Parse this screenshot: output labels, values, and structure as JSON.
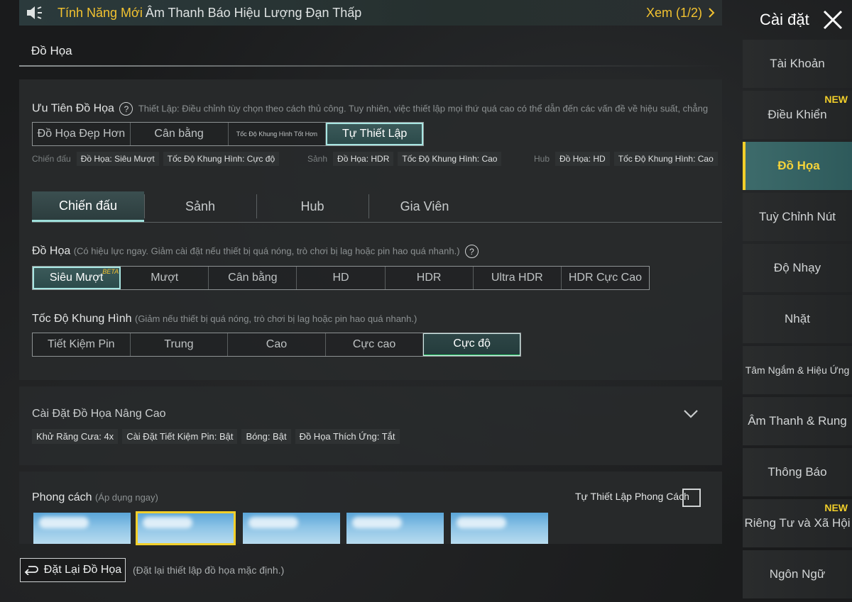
{
  "announcement": {
    "highlight": "Tính Năng Mới",
    "text": "Âm Thanh Báo Hiệu Lượng Đạn Thấp",
    "view": "Xem (1/2)"
  },
  "page": {
    "title": "Đồ Họa"
  },
  "priority": {
    "title": "Ưu Tiên Đồ Họa",
    "desc": "Thiết Lập: Điều chỉnh tùy chọn theo cách thủ công. Tuy nhiên, việc thiết lập mọi thứ quá cao có thể dẫn đến các vấn đề về hiệu suất, chẳng",
    "options": [
      "Đồ Họa Đẹp Hơn",
      "Cân bằng",
      "Tốc Độ Khung Hình Tốt Hơn",
      "Tự Thiết Lập"
    ],
    "selected": "Tự Thiết Lập",
    "summary": {
      "battle_label": "Chiến đấu",
      "battle_tags": [
        "Đồ Họa: Siêu Mượt",
        "Tốc Độ Khung Hình: Cực độ"
      ],
      "lobby_label": "Sảnh",
      "lobby_tags": [
        "Đồ Họa: HDR",
        "Tốc Độ Khung Hình: Cao"
      ],
      "hub_label": "Hub",
      "hub_tags": [
        "Đồ Họa: HD",
        "Tốc Độ Khung Hình: Cao"
      ]
    }
  },
  "tabs": [
    "Chiến đấu",
    "Sảnh",
    "Hub",
    "Gia Viên"
  ],
  "active_tab": "Chiến đấu",
  "graphics": {
    "title": "Đồ Họa",
    "sub": "(Có hiệu lực ngay. Giảm cài đặt nếu thiết bị quá nóng, trò chơi bị lag hoặc pin hao quá nhanh.)",
    "options": [
      "Siêu Mượt",
      "Mượt",
      "Cân bằng",
      "HD",
      "HDR",
      "Ultra HDR",
      "HDR Cực Cao"
    ],
    "beta": "BETA",
    "selected": "Siêu Mượt"
  },
  "framerate": {
    "title": "Tốc Độ Khung Hình",
    "sub": "(Giảm nếu thiết bị quá nóng, trò chơi bị lag hoặc pin hao quá nhanh.)",
    "options": [
      "Tiết Kiệm Pin",
      "Trung",
      "Cao",
      "Cực cao",
      "Cực độ"
    ],
    "selected": "Cực độ"
  },
  "advanced": {
    "title": "Cài Đặt Đồ Họa Nâng Cao",
    "tags": [
      "Khử Răng Cưa: 4x",
      "Cài Đặt Tiết Kiệm Pin: Bật",
      "Bóng: Bật",
      "Đồ Họa Thích Ứng: Tắt"
    ]
  },
  "style": {
    "title": "Phong cách",
    "sub": "(Áp dụng ngay)",
    "custom_label": "Tự Thiết Lập Phong Cách",
    "selected_index": 1
  },
  "reset": {
    "label": "Đặt Lại Đồ Họa",
    "note": "(Đặt lại thiết lập đồ họa mặc định.)"
  },
  "sidebar": {
    "title": "Cài đặt",
    "new_badge": "NEW",
    "items": [
      {
        "label": "Tài Khoản"
      },
      {
        "label": "Điều Khiển",
        "new": true
      },
      {
        "label": "Đồ Họa",
        "active": true
      },
      {
        "label": "Tuỳ Chỉnh Nút"
      },
      {
        "label": "Độ Nhạy"
      },
      {
        "label": "Nhặt"
      },
      {
        "label": "Tâm Ngắm & Hiệu Ứng"
      },
      {
        "label": "Âm Thanh & Rung"
      },
      {
        "label": "Thông Báo"
      },
      {
        "label": "Riêng Tư và Xã Hội",
        "new": true
      },
      {
        "label": "Ngôn Ngữ"
      }
    ]
  },
  "colors": {
    "accent": "#f2cf2a",
    "selected_teal": "#a8e6e2",
    "active_bg": "#3d6b6b"
  }
}
